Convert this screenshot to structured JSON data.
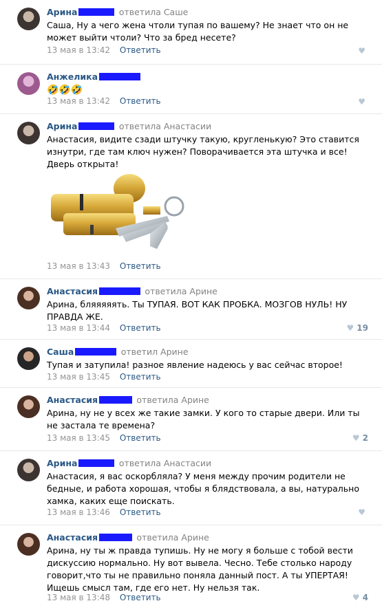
{
  "comments": [
    {
      "author": "Арина",
      "reply": "ответила Саше",
      "text": "Саша, Ну а чего жена чтоли тупая по вашему? Не знает что он не может выйти чтоли? Что за бред несете?",
      "date": "13 мая в 13:42",
      "reply_label": "Ответить",
      "likes": ""
    },
    {
      "author": "Анжелика",
      "reply": "",
      "text": "🤣🤣🤣",
      "date": "13 мая в 13:42",
      "reply_label": "Ответить",
      "likes": ""
    },
    {
      "author": "Арина",
      "reply": "ответила Анастасии",
      "text": "Анастасия, видите сзади штучку такую, кругленькую? Это ставится изнутри, где там ключ нужен? Поворачивается эта штучка и все! Дверь открыта!",
      "date": "13 мая в 13:43",
      "reply_label": "Ответить",
      "likes": ""
    },
    {
      "author": "Анастасия",
      "reply": "ответила Арине",
      "text": "Арина, бляяяяять. Ты ТУПАЯ. ВОТ КАК ПРОБКА. МОЗГОВ НУЛЬ! НУ ПРАВДА ЖЕ.",
      "date": "13 мая в 13:44",
      "reply_label": "Ответить",
      "likes": "19"
    },
    {
      "author": "Саша",
      "reply": "ответил Арине",
      "text": "Тупая и затупила! разное явление надеюсь у вас сейчас второе!",
      "date": "13 мая в 13:45",
      "reply_label": "Ответить",
      "likes": ""
    },
    {
      "author": "Анастасия",
      "reply": "ответила Арине",
      "text": "Арина, ну не у всех же такие замки. У кого то старые двери. Или ты не застала те времена?",
      "date": "13 мая в 13:45",
      "reply_label": "Ответить",
      "likes": "2"
    },
    {
      "author": "Арина",
      "reply": "ответила Анастасии",
      "text": "Анастасия, я вас оскорбляла? У меня между прочим родители не бедные, и работа хорошая, чтобы я блядствовала, а вы, натурально хамка, каких еще поискать.",
      "date": "13 мая в 13:46",
      "reply_label": "Ответить",
      "likes": ""
    },
    {
      "author": "Анастасия",
      "reply": "ответила Арине",
      "text": "Арина, ну ты ж правда тупишь. Ну не могу я больше с тобой вести дискуссию нормально. Ну вот вывела. Чесно. Тебе столько народу говорит,что ты не правильно поняла данный пост. А ты УПЕРТАЯ! Ищешь смысл там, где его нет. Ну нельзя так.",
      "date": "13 мая в 13:48",
      "reply_label": "Ответить",
      "likes": "4"
    }
  ],
  "colors": {
    "link": "#2a5885",
    "meta": "#939393",
    "redaction": "#1a1aff",
    "divider": "#e7e8ec"
  },
  "icons": [
    "heart-icon",
    "lock-cylinder-image"
  ]
}
